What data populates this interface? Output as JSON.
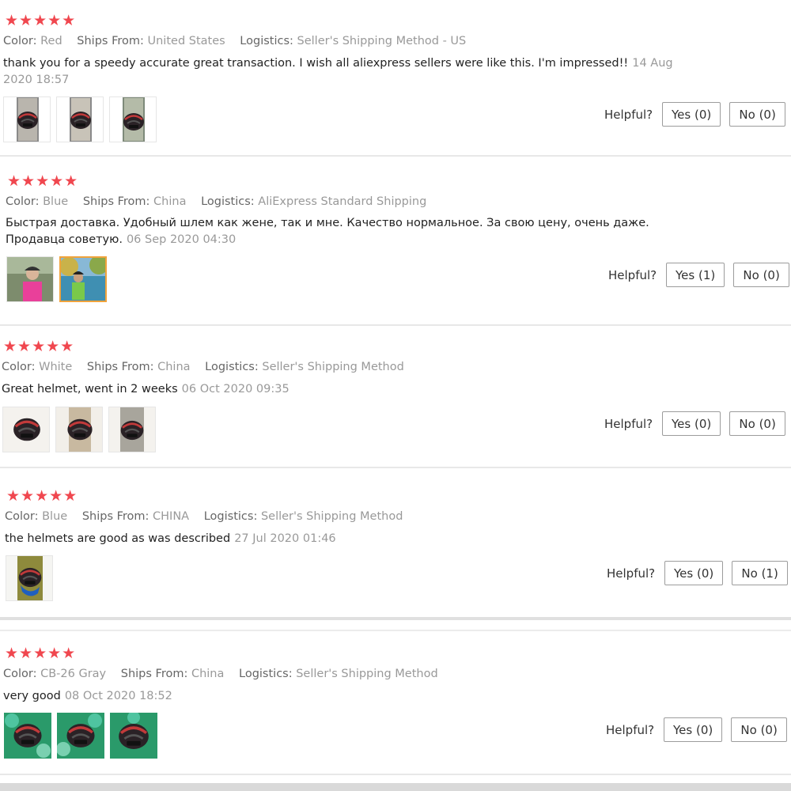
{
  "labels": {
    "color": "Color:",
    "ships_from": "Ships From:",
    "logistics": "Logistics:",
    "helpful": "Helpful?"
  },
  "reviews": [
    {
      "stars": "★★★★★",
      "color": "Red",
      "ships_from": "United States",
      "logistics": "Seller's Shipping Method - US",
      "text": "thank you for a speedy accurate great transaction. I wish all aliexpress sellers were like this. I'm impressed!!",
      "date": "14 Aug 2020 18:57",
      "yes": "Yes (0)",
      "no": "No (0)"
    },
    {
      "stars": "★★★★★",
      "color": "Blue",
      "ships_from": "China",
      "logistics": "AliExpress Standard Shipping",
      "text": "Быстрая доставка. Удобный шлем как жене, так и мне. Качество нормальное. За свою цену, очень даже. Продавца советую.",
      "date": "06 Sep 2020 04:30",
      "yes": "Yes (1)",
      "no": "No (0)"
    },
    {
      "stars": "★★★★★",
      "color": "White",
      "ships_from": "China",
      "logistics": "Seller's Shipping Method",
      "text": "Great helmet, went in 2 weeks",
      "date": "06 Oct 2020 09:35",
      "yes": "Yes (0)",
      "no": "No (0)"
    },
    {
      "stars": "★★★★★",
      "color": "Blue",
      "ships_from": "CHINA",
      "logistics": "Seller's Shipping Method",
      "text": "the helmets are good as was described",
      "date": "27 Jul 2020 01:46",
      "yes": "Yes (0)",
      "no": "No (1)"
    },
    {
      "stars": "★★★★★",
      "color": "CB-26 Gray",
      "ships_from": "China",
      "logistics": "Seller's Shipping Method",
      "text": "very good",
      "date": "08 Oct 2020 18:52",
      "yes": "Yes (0)",
      "no": "No (0)"
    }
  ]
}
